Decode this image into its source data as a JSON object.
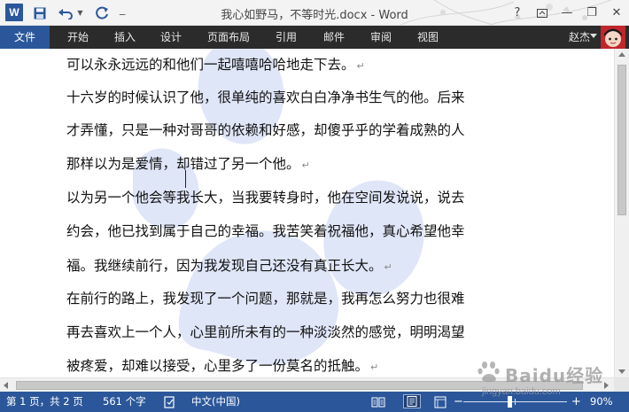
{
  "app": {
    "title": "我心如野马，不等时光.docx - Word",
    "logo_letter": "W"
  },
  "window_controls": {
    "help": "?",
    "minimize": "—",
    "restore": "❐",
    "close": "✕"
  },
  "ribbon": {
    "tabs": [
      {
        "label": "文件"
      },
      {
        "label": "开始"
      },
      {
        "label": "插入"
      },
      {
        "label": "设计"
      },
      {
        "label": "页面布局"
      },
      {
        "label": "引用"
      },
      {
        "label": "邮件"
      },
      {
        "label": "审阅"
      },
      {
        "label": "视图"
      }
    ],
    "user_name": "赵杰"
  },
  "document": {
    "lines": [
      {
        "text": "可以永永远远的和他们一起嘻嘻哈哈地走下去。",
        "mark": "↵"
      },
      {
        "text": "十六岁的时候认识了他，很单纯的喜欢白白净净书生气的他。后来",
        "mark": ""
      },
      {
        "text": "才弄懂，只是一种对哥哥的依赖和好感，却傻乎乎的学着成熟的人",
        "mark": ""
      },
      {
        "text": "那样以为是爱情，却错过了另一个他。",
        "mark": "↵"
      },
      {
        "text": "以为另一个他会等我长大，当我要转身时，他在空间发说说，说去",
        "mark": ""
      },
      {
        "text": "约会，他已找到属于自己的幸福。我苦笑着祝福他，真心希望他幸",
        "mark": ""
      },
      {
        "text": "福。我继续前行，因为我发现自己还没有真正长大。",
        "mark": "↵"
      },
      {
        "text": "在前行的路上，我发现了一个问题，那就是，我再怎么努力也很难",
        "mark": ""
      },
      {
        "text": "再去喜欢上一个人，心里前所未有的一种淡淡然的感觉，明明渴望",
        "mark": ""
      },
      {
        "text": "被疼爱，却难以接受，心里多了一份莫名的抵触。",
        "mark": "↵"
      }
    ]
  },
  "status": {
    "page_info": "第 1 页，共 2 页",
    "word_count": "561 个字",
    "language": "中文(中国)",
    "zoom_minus": "−",
    "zoom_plus": "+",
    "zoom_percent": "90%",
    "zoom_value": 90
  },
  "watermark": {
    "text": "Baidu经验",
    "url": "jingyan.baidu.com"
  },
  "colors": {
    "accent": "#2b579a",
    "tab_bar": "#2b2b2b",
    "paw": "#dfe6f8"
  }
}
